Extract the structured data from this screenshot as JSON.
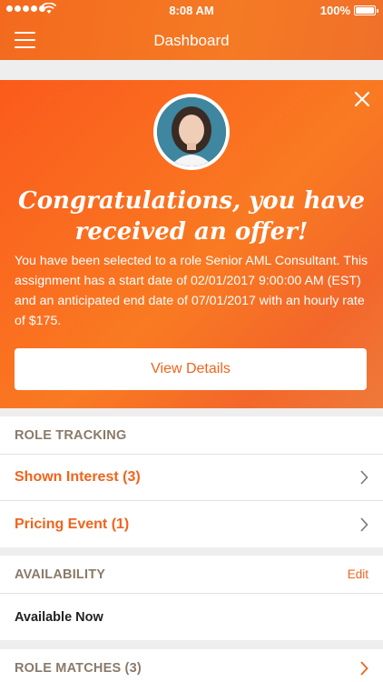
{
  "status_bar": {
    "time": "8:08 AM",
    "battery": "100%",
    "signal_icon": "signal-dots-icon",
    "wifi_icon": "wifi-icon",
    "battery_icon": "battery-icon"
  },
  "nav": {
    "title": "Dashboard",
    "menu_icon": "hamburger-menu-icon"
  },
  "offer": {
    "title": "Congratulations, you have received an offer!",
    "body": "You have been selected to a role Senior AML Consultant. This assignment has a start date of 02/01/2017 9:00:00 AM (EST) and an anticipated end date of 07/01/2017 with an hourly rate of $175.",
    "button": "View Details",
    "close_icon": "close-icon"
  },
  "role_tracking": {
    "title": "ROLE TRACKING",
    "items": [
      {
        "label": "Shown Interest (3)"
      },
      {
        "label": "Pricing Event (1)"
      }
    ]
  },
  "availability": {
    "title": "AVAILABILITY",
    "edit": "Edit",
    "value": "Available Now"
  },
  "role_matches": {
    "title": "ROLE MATCHES (3)"
  },
  "colors": {
    "accent": "#f0641c",
    "section_title": "#8a7a6a"
  }
}
